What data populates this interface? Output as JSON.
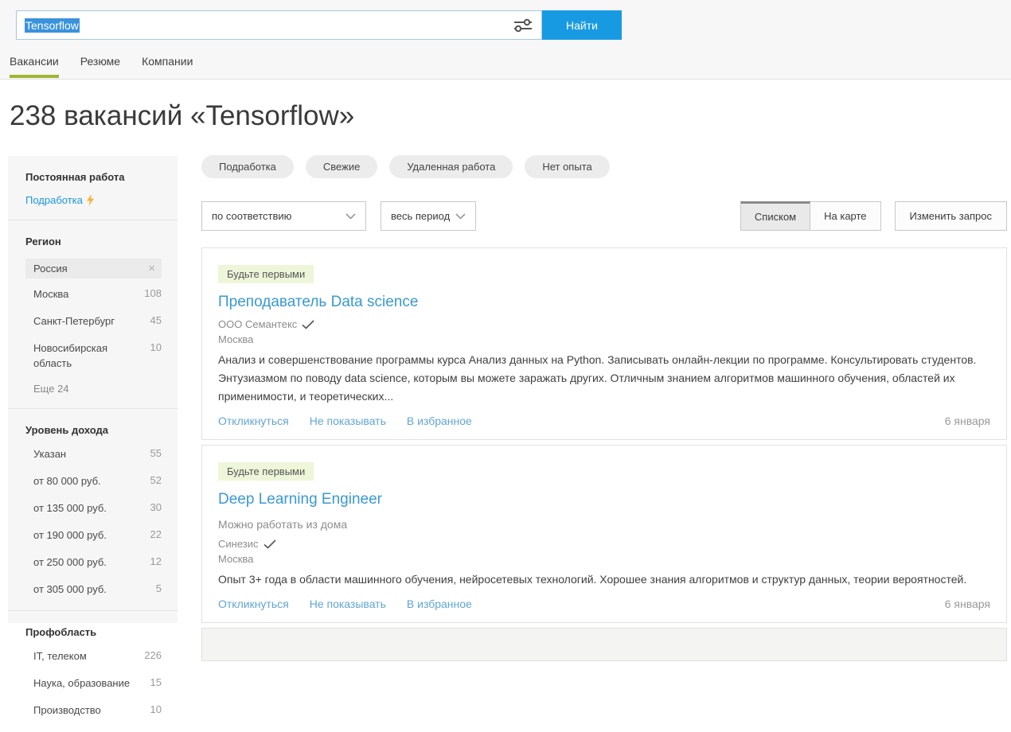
{
  "search": {
    "query": "Tensorflow",
    "find_button": "Найти"
  },
  "tabs": {
    "vacancies": "Вакансии",
    "resumes": "Резюме",
    "companies": "Компании"
  },
  "page_title": "238 вакансий «Tensorflow»",
  "sidebar": {
    "employment": {
      "title": "Постоянная работа",
      "part_time_link": "Подработка"
    },
    "region": {
      "title": "Регион",
      "selected": "Россия",
      "items": [
        {
          "label": "Москва",
          "count": "108"
        },
        {
          "label": "Санкт-Петербург",
          "count": "45"
        },
        {
          "label": "Новосибирская область",
          "count": "10"
        }
      ],
      "more": "Еще 24"
    },
    "income": {
      "title": "Уровень дохода",
      "items": [
        {
          "label": "Указан",
          "count": "55"
        },
        {
          "label": "от 80 000 руб.",
          "count": "52"
        },
        {
          "label": "от 135 000 руб.",
          "count": "30"
        },
        {
          "label": "от 190 000 руб.",
          "count": "22"
        },
        {
          "label": "от 250 000 руб.",
          "count": "12"
        },
        {
          "label": "от 305 000 руб.",
          "count": "5"
        }
      ]
    },
    "profarea": {
      "title": "Профобласть",
      "items": [
        {
          "label": "IT, телеком",
          "count": "226"
        },
        {
          "label": "Наука, образование",
          "count": "15"
        },
        {
          "label": "Производство",
          "count": "10"
        }
      ]
    }
  },
  "quick_filters": [
    "Подработка",
    "Свежие",
    "Удаленная работа",
    "Нет опыта"
  ],
  "controls": {
    "sort": "по соответствию",
    "period": "весь период",
    "list_view": "Списком",
    "map_view": "На карте",
    "edit_query": "Изменить запрос"
  },
  "card_actions": {
    "apply": "Откликнуться",
    "hide": "Не показывать",
    "favorite": "В избранное"
  },
  "cards": [
    {
      "badge": "Будьте первыми",
      "title": "Преподаватель Data science",
      "company": "ООО Семантекс",
      "city": "Москва",
      "description": "Анализ и совершенствование программы курса Анализ данных на Python. Записывать онлайн-лекции по программе. Консультировать студентов. Энтузиазмом по поводу data science, которым вы можете заражать других. Отличным знанием алгоритмов машинного обучения, областей их применимости, и теоретических...",
      "date": "6 января"
    },
    {
      "badge": "Будьте первыми",
      "title": "Deep Learning Engineer",
      "remote": "Можно работать из дома",
      "company": "Синезис",
      "city": "Москва",
      "description": "Опыт 3+ года в области машинного обучения, нейросетевых технологий. Хорошее знания алгоритмов и структур данных, теории вероятностей.",
      "date": "6 января"
    }
  ]
}
